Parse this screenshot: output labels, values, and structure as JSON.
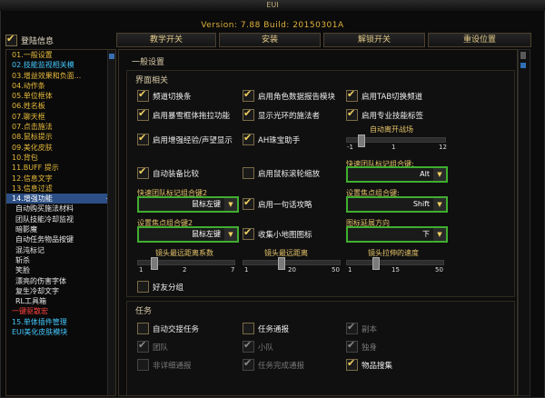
{
  "window": {
    "title": "EUI",
    "version": "Version: 7.88 Build: 20150301A"
  },
  "root_option": {
    "label": "登陆信息",
    "checked": true
  },
  "top_buttons": [
    "教学开关",
    "安装",
    "解锁开关",
    "重设位置"
  ],
  "sidebar": {
    "items": [
      {
        "label": "01.一般设置",
        "type": "t1"
      },
      {
        "label": "02.技能监视相关模",
        "type": "t4",
        "plus": true
      },
      {
        "label": "03.增益效果和负面...",
        "type": "t1",
        "plus": true
      },
      {
        "label": "04.动作条",
        "type": "t1",
        "plus": true
      },
      {
        "label": "05.单位框体",
        "type": "t1",
        "plus": true
      },
      {
        "label": "06.姓名板",
        "type": "t1",
        "plus": true
      },
      {
        "label": "07.聊天框",
        "type": "t1",
        "plus": true
      },
      {
        "label": "07.点击施法",
        "type": "t1",
        "plus": true
      },
      {
        "label": "08.鼠标提示",
        "type": "t1",
        "plus": true
      },
      {
        "label": "09.美化皮肤",
        "type": "t1",
        "plus": true
      },
      {
        "label": "10.背包",
        "type": "t1",
        "plus": true
      },
      {
        "label": "11.BUFF 提示",
        "type": "t1",
        "plus": true
      },
      {
        "label": "12.信息文字",
        "type": "t1",
        "plus": true
      },
      {
        "label": "13.信息过滤",
        "type": "t1",
        "plus": true
      },
      {
        "label": "14.增强功能",
        "type": "t1",
        "selected": true,
        "collapse": "−"
      },
      {
        "label": "自动购买施法材料",
        "type": "t2"
      },
      {
        "label": "团队技能冷却监视",
        "type": "t2"
      },
      {
        "label": "暗影魔",
        "type": "t2"
      },
      {
        "label": "自动任务物品按键",
        "type": "t2"
      },
      {
        "label": "混沌标记",
        "type": "t2"
      },
      {
        "label": "斩杀",
        "type": "t2"
      },
      {
        "label": "笑脸",
        "type": "t2"
      },
      {
        "label": "漂亮的伤害字体",
        "type": "t2"
      },
      {
        "label": "复生冷却文字",
        "type": "t2"
      },
      {
        "label": "RL工具箱",
        "type": "t2"
      },
      {
        "label": "一键驱散宏",
        "type": "t3"
      },
      {
        "label": "15.单体插件管理",
        "type": "t4",
        "plus": true
      },
      {
        "label": "EUI美化皮肤模块",
        "type": "t4",
        "plus": true
      }
    ]
  },
  "general": {
    "title": "一般设置",
    "interface_title": "界面相关",
    "checks": [
      {
        "label": "频道切换条",
        "checked": true
      },
      {
        "label": "启用角色数据报告模块",
        "checked": true
      },
      {
        "label": "启用TAB切换频道",
        "checked": true
      },
      {
        "label": "启用暴雪框体拖拉功能",
        "checked": true
      },
      {
        "label": "显示光环的施法者",
        "checked": true
      },
      {
        "label": "启用专业技能标签",
        "checked": true
      },
      {
        "label": "启用增强经验/声望显示",
        "checked": true
      },
      {
        "label": "AH珠宝助手",
        "checked": true
      },
      {
        "label": "自动装备比较",
        "checked": true
      },
      {
        "label": "启用鼠标滚轮缩放",
        "checked": false
      },
      {
        "label": "启用一句话攻略",
        "checked": true
      },
      {
        "label": "收集小地图图标",
        "checked": true
      },
      {
        "label": "好友分组",
        "checked": false
      }
    ],
    "auto_leave": {
      "label": "自动离开战场",
      "min": "-1",
      "value": "1",
      "max": "12"
    },
    "dropdowns": [
      {
        "label": "快速团队标记组合键:",
        "value": "Alt"
      },
      {
        "label": "快速团队标记组合键2",
        "value": "鼠标左键"
      },
      {
        "label": "设置焦点组合键:",
        "value": "Shift"
      },
      {
        "label": "设置焦点组合键2",
        "value": "鼠标左键"
      },
      {
        "label": "图标延展方向",
        "value": "下"
      }
    ],
    "sliders": [
      {
        "label": "镜头最远距离系数",
        "min": "1",
        "value": "2",
        "max": "7"
      },
      {
        "label": "镜头最远距离",
        "min": "1",
        "value": "20",
        "max": "50"
      },
      {
        "label": "镜头拉伸的速度",
        "min": "1",
        "value": "15",
        "max": "50"
      }
    ]
  },
  "tasks": {
    "title": "任务",
    "checks": [
      {
        "label": "自动交接任务",
        "checked": false,
        "dim": false
      },
      {
        "label": "任务通报",
        "checked": false,
        "dim": false
      },
      {
        "label": "副本",
        "checked": true,
        "dim": true
      },
      {
        "label": "团队",
        "checked": true,
        "dim": true
      },
      {
        "label": "小队",
        "checked": true,
        "dim": true
      },
      {
        "label": "独身",
        "checked": true,
        "dim": true
      },
      {
        "label": "非详细通报",
        "checked": false,
        "dim": true
      },
      {
        "label": "任务完成通报",
        "checked": true,
        "dim": true
      },
      {
        "label": "物品搜集",
        "checked": true,
        "dim": false
      }
    ]
  },
  "colors": {
    "accent": "#e6b93c",
    "selected": "#2c4f86",
    "dropdown_border": "#3fae2f"
  }
}
